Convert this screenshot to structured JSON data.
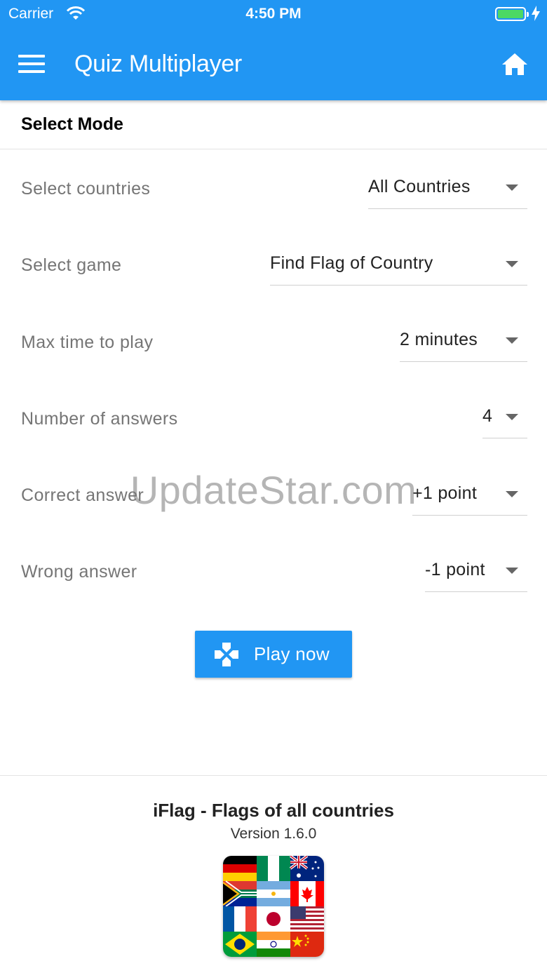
{
  "status_bar": {
    "carrier": "Carrier",
    "time": "4:50 PM"
  },
  "app_bar": {
    "title": "Quiz Multiplayer",
    "menu_icon": "hamburger-menu-icon",
    "home_icon": "home-icon"
  },
  "section": {
    "title": "Select Mode"
  },
  "settings": [
    {
      "label": "Select countries",
      "value": "All Countries"
    },
    {
      "label": "Select game",
      "value": "Find Flag of Country"
    },
    {
      "label": "Max time to play",
      "value": "2 minutes"
    },
    {
      "label": "Number of answers",
      "value": "4"
    },
    {
      "label": "Correct answer",
      "value": "+1 point"
    },
    {
      "label": "Wrong answer",
      "value": "-1 point"
    }
  ],
  "play_button": {
    "label": "Play now",
    "icon": "gamepad-icon"
  },
  "watermark": "UpdateStar.com",
  "footer": {
    "app_name": "iFlag - Flags of all countries",
    "version": "Version 1.6.0",
    "app_icon": "flags-collage-icon"
  },
  "colors": {
    "primary": "#2196f3",
    "battery": "#4cd964"
  }
}
